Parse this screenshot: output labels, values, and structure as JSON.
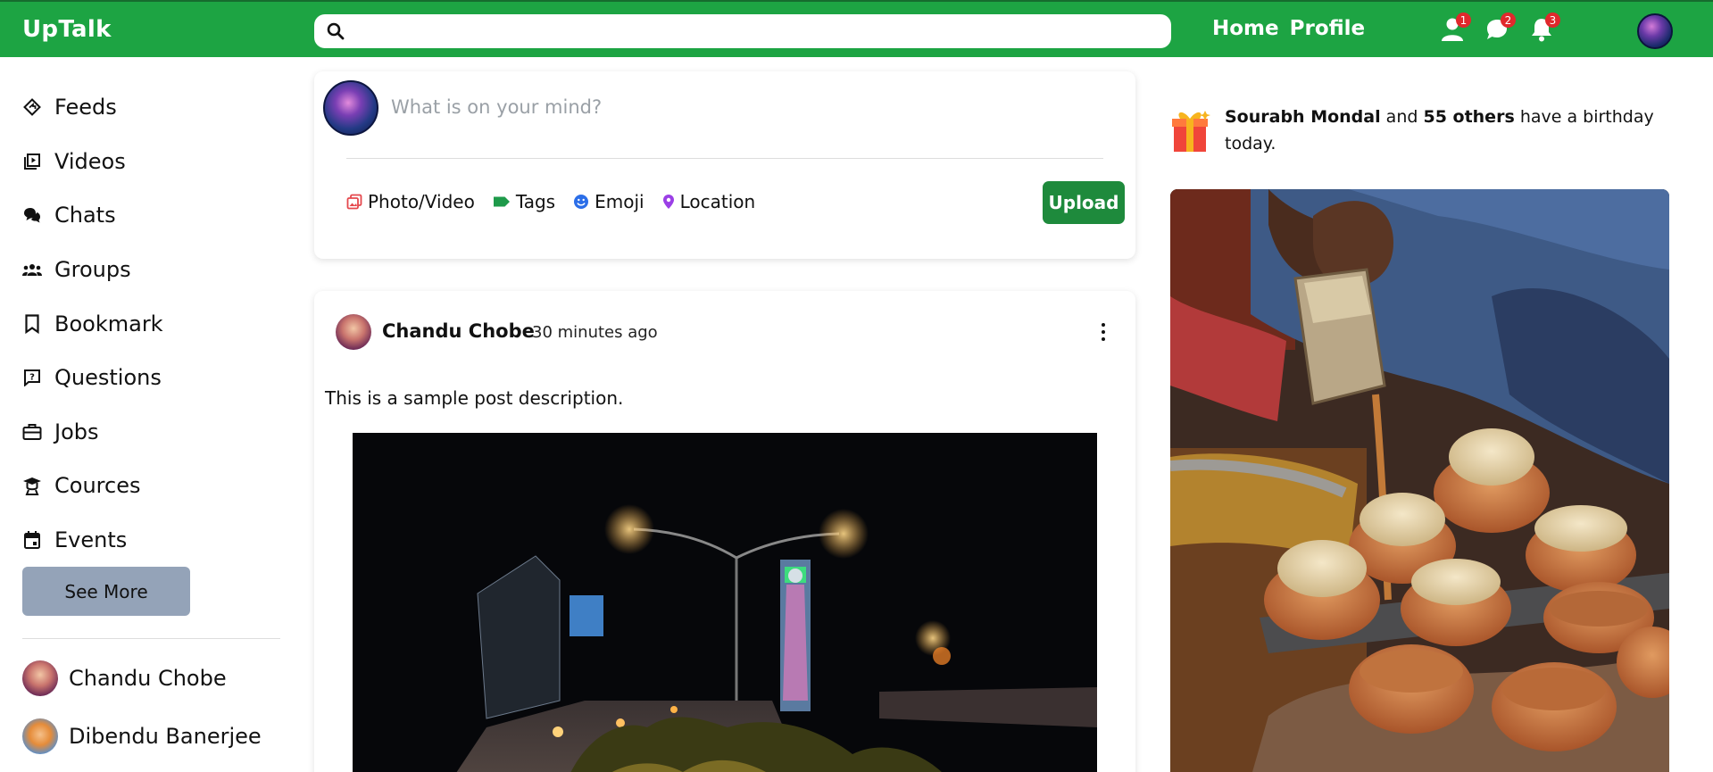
{
  "app": {
    "title": "UpTalk"
  },
  "header": {
    "search_placeholder": "",
    "nav": [
      "Home",
      "Profile"
    ],
    "badges": {
      "friends": "1",
      "messages": "2",
      "notifications": "3"
    }
  },
  "sidebar": {
    "items": [
      {
        "label": "Feeds",
        "icon": "feeds-icon"
      },
      {
        "label": "Videos",
        "icon": "video-icon"
      },
      {
        "label": "Chats",
        "icon": "chat-icon"
      },
      {
        "label": "Groups",
        "icon": "groups-icon"
      },
      {
        "label": "Bookmark",
        "icon": "bookmark-icon"
      },
      {
        "label": "Questions",
        "icon": "question-icon"
      },
      {
        "label": "Jobs",
        "icon": "briefcase-icon"
      },
      {
        "label": "Cources",
        "icon": "graduation-icon"
      },
      {
        "label": "Events",
        "icon": "calendar-icon"
      }
    ],
    "see_more": "See More",
    "friends": [
      {
        "name": "Chandu Chobe"
      },
      {
        "name": "Dibendu Banerjee"
      }
    ]
  },
  "composer": {
    "placeholder": "What is on your mind?",
    "actions": [
      "Photo/Video",
      "Tags",
      "Emoji",
      "Location"
    ],
    "upload": "Upload"
  },
  "post": {
    "author": "Chandu Chobe",
    "time": "30 minutes ago",
    "description": "This is a sample post description."
  },
  "birthday": {
    "name": "Sourabh Mondal",
    "connector": "and",
    "others": "55 others",
    "suffix": "have a birthday today."
  },
  "colors": {
    "brand_green": "#1da443",
    "upload_green": "#1e8a3c",
    "badge_red": "#e0282c",
    "see_more_bg": "#94a3b8"
  }
}
